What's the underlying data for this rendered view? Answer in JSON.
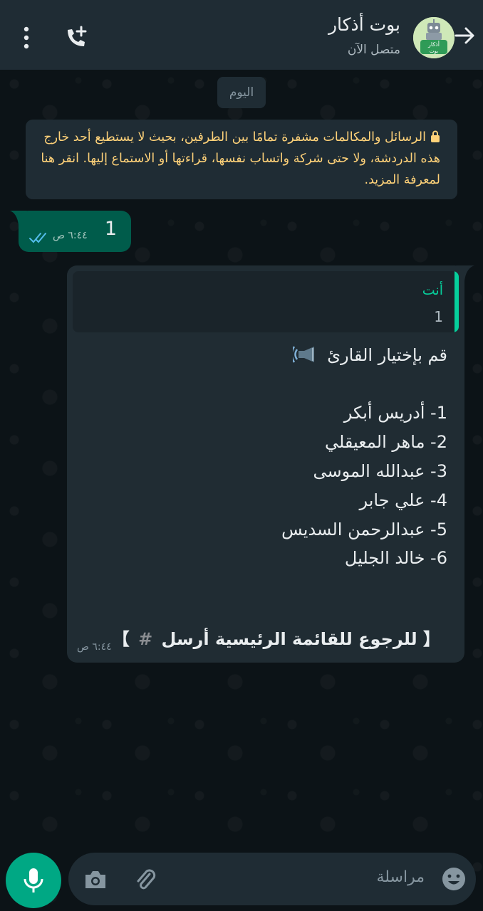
{
  "header": {
    "contact_name": "بوت أذكار",
    "status": "متصل الآن",
    "avatar_text": "أذكار بوت"
  },
  "date_chip": "اليوم",
  "encryption_notice": "الرسائل والمكالمات مشفرة تمامًا بين الطرفين، بحيث لا يستطيع أحد خارج هذه الدردشة، ولا حتى شركة واتساب نفسها، قراءتها أو الاستماع إليها. انقر هنا لمعرفة المزيد.",
  "outgoing": {
    "text": "1",
    "time": "٦:٤٤ ص",
    "status": "read"
  },
  "incoming": {
    "quote_author": "أنت",
    "quote_text": "1",
    "title": "قم بإختيار القارئ",
    "readers": [
      "1- أدريس أبكر",
      "2- ماهر المعيقلي",
      "3- عبدالله الموسى",
      "4- علي جابر",
      "5- عبدالرحمن السديس",
      "6- خالد الجليل"
    ],
    "footer_open": "【",
    "footer_text": "للرجوع للقائمة الرئيسية أرسل",
    "footer_hash": "#",
    "footer_close": "】",
    "time": "٦:٤٤ ص"
  },
  "input": {
    "placeholder": "مراسلة"
  },
  "colors": {
    "header_bg": "#1f2c34",
    "chat_bg": "#0c1317",
    "outgoing_bubble": "#005c4b",
    "incoming_bubble": "#202c33",
    "accent": "#00a884",
    "quote_accent": "#06cf9c",
    "notice_text": "#ffd279"
  },
  "icons": [
    "back-arrow-icon",
    "bot-avatar",
    "add-call-icon",
    "more-vert-icon",
    "lock-icon",
    "double-check-icon",
    "speaker-icon",
    "emoji-icon",
    "attach-icon",
    "camera-icon",
    "mic-icon"
  ]
}
